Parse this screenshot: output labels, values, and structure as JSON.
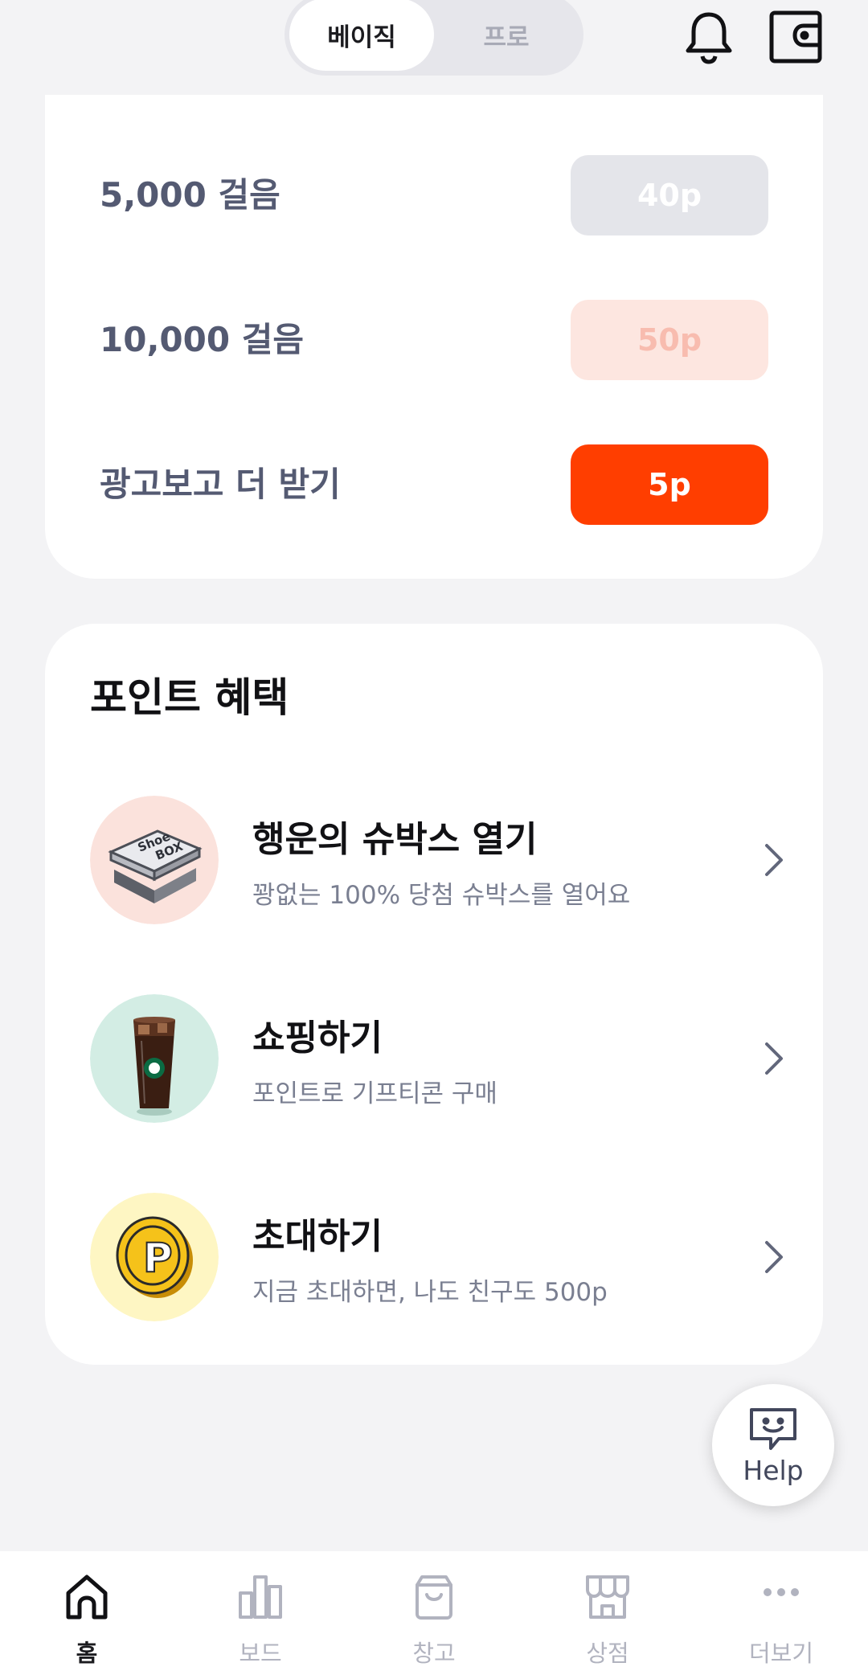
{
  "header": {
    "mode_options": [
      "베이직",
      "프로"
    ],
    "active_mode": "베이직",
    "icons": [
      "bell-icon",
      "wallet-icon"
    ]
  },
  "steps": {
    "rows": [
      {
        "label": "5,000 걸음",
        "reward": "40p",
        "state": "claimed"
      },
      {
        "label": "10,000 걸음",
        "reward": "50p",
        "state": "locked"
      },
      {
        "label": "광고보고 더 받기",
        "reward": "5p",
        "state": "available"
      }
    ]
  },
  "benefits": {
    "title": "포인트 혜택",
    "items": [
      {
        "title": "행운의 슈박스 열기",
        "subtitle": "꽝없는 100% 당첨 슈박스를 열어요",
        "icon": "shoebox-icon",
        "thumb_color": "#fbe2dc"
      },
      {
        "title": "쇼핑하기",
        "subtitle": "포인트로 기프티콘 구매",
        "icon": "iced-coffee-icon",
        "thumb_color": "#d3ede4"
      },
      {
        "title": "초대하기",
        "subtitle": "지금 초대하면, 나도 친구도 500p",
        "icon": "point-coin-icon",
        "thumb_color": "#fef6c3"
      }
    ]
  },
  "help": {
    "label": "Help"
  },
  "bottom_nav": {
    "items": [
      {
        "label": "홈",
        "icon": "home-icon",
        "active": true
      },
      {
        "label": "보드",
        "icon": "chart-icon",
        "active": false
      },
      {
        "label": "창고",
        "icon": "bag-icon",
        "active": false
      },
      {
        "label": "상점",
        "icon": "store-icon",
        "active": false
      },
      {
        "label": "더보기",
        "icon": "more-icon",
        "active": false
      }
    ]
  },
  "colors": {
    "accent": "#ff3e00",
    "background": "#f3f3f5",
    "card": "#ffffff",
    "nav_inactive": "#b1b3bf"
  }
}
